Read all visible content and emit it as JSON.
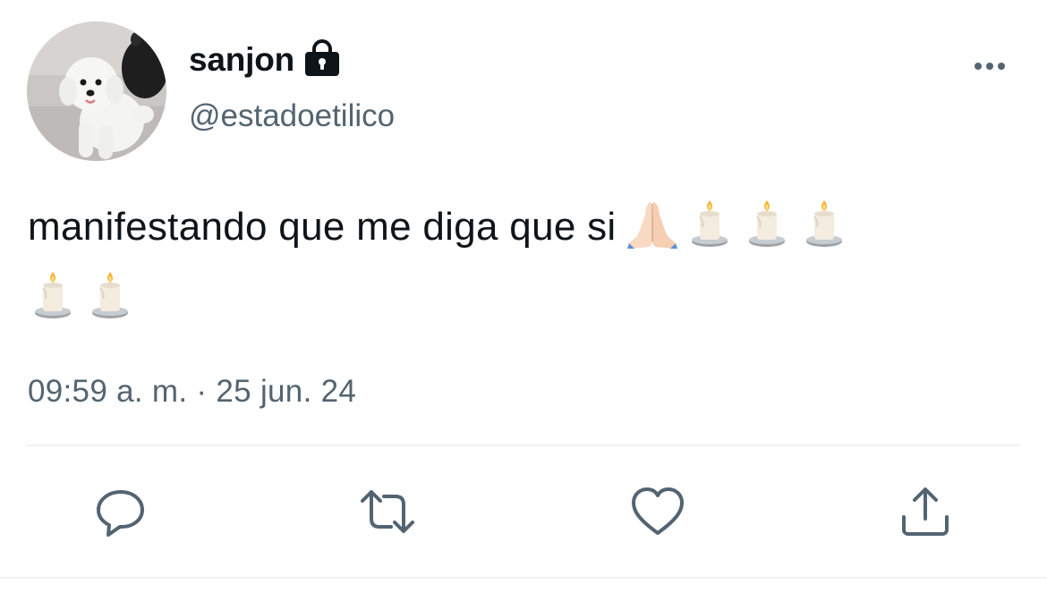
{
  "user": {
    "display_name": "sanjon",
    "handle": "@estadoetilico",
    "protected": true
  },
  "tweet": {
    "text": "manifestando que me diga que si",
    "emojis": [
      "folded-hands",
      "candle",
      "candle",
      "candle",
      "candle",
      "candle"
    ],
    "timestamp": "09:59 a. m. · 25 jun. 24"
  },
  "actions": [
    "reply-icon",
    "retweet-icon",
    "like-icon",
    "share-icon"
  ],
  "colors": {
    "text_primary": "#0f1419",
    "text_secondary": "#536471",
    "divider": "#eff3f4"
  }
}
